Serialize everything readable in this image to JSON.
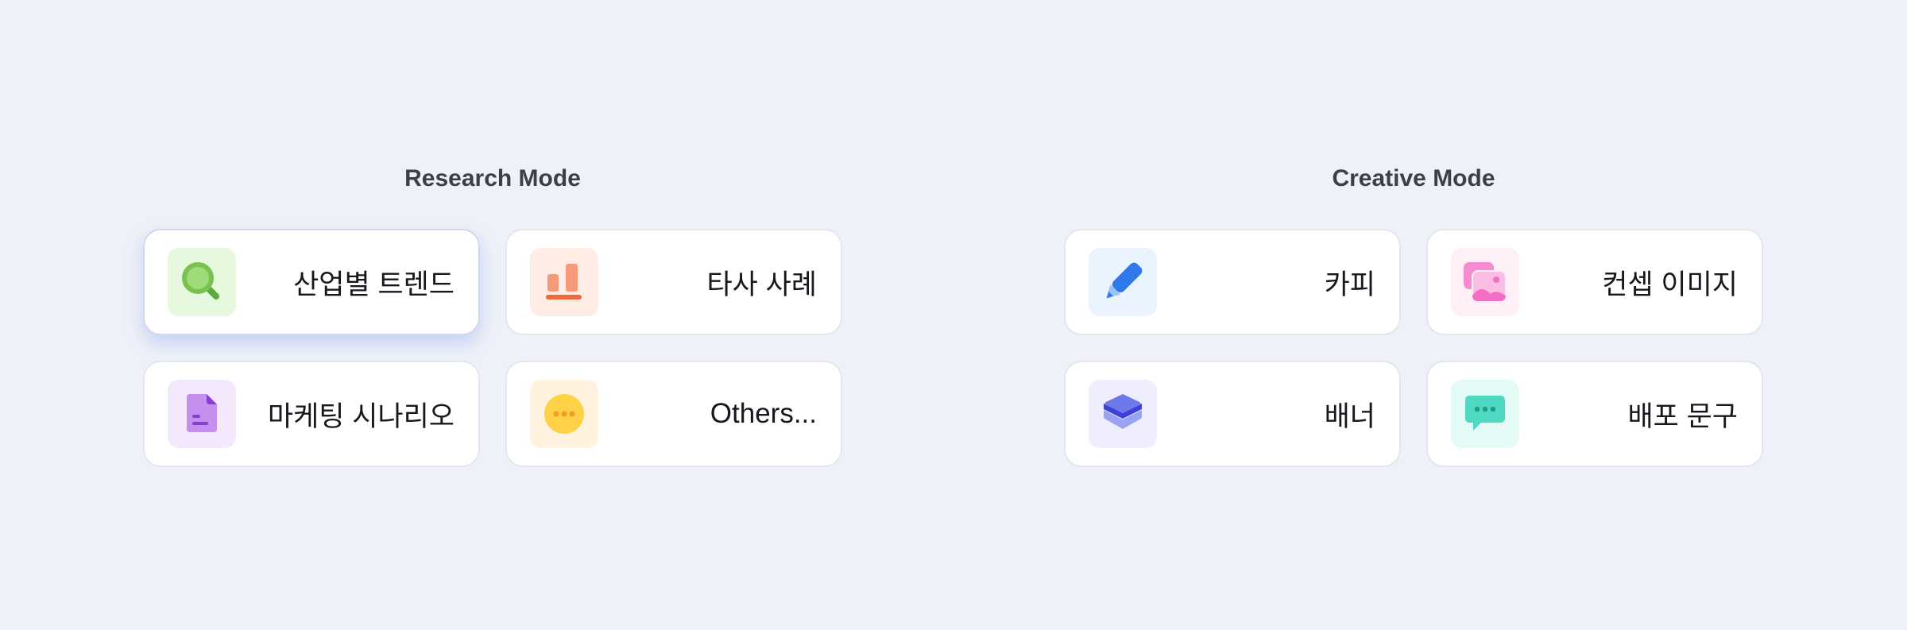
{
  "research": {
    "title": "Research Mode",
    "items": [
      {
        "label": "산업별 트렌드",
        "icon": "search-icon",
        "icon_bg": "#e6f8de",
        "icon_color": "#78c251",
        "active": true
      },
      {
        "label": "타사 사례",
        "icon": "bar-chart-icon",
        "icon_bg": "#ffece5",
        "icon_color": "#f59a7a"
      },
      {
        "label": "마케팅 시나리오",
        "icon": "document-icon",
        "icon_bg": "#f3e8fc",
        "icon_color": "#c58ff0"
      },
      {
        "label": "Others...",
        "icon": "more-icon",
        "icon_bg": "#fff2de",
        "icon_color": "#ffd147"
      }
    ]
  },
  "creative": {
    "title": "Creative Mode",
    "items": [
      {
        "label": "카피",
        "icon": "pencil-icon",
        "icon_bg": "#eaf4ff",
        "icon_color": "#2f79ea"
      },
      {
        "label": "컨셉 이미지",
        "icon": "image-icon",
        "icon_bg": "#fff0f8",
        "icon_color": "#f78bd1"
      },
      {
        "label": "배너",
        "icon": "layers-icon",
        "icon_bg": "#eeeefe",
        "icon_color": "#6c79e8"
      },
      {
        "label": "배포 문구",
        "icon": "chat-bubble-icon",
        "icon_bg": "#e4faf6",
        "icon_color": "#4fd8c2"
      }
    ]
  }
}
